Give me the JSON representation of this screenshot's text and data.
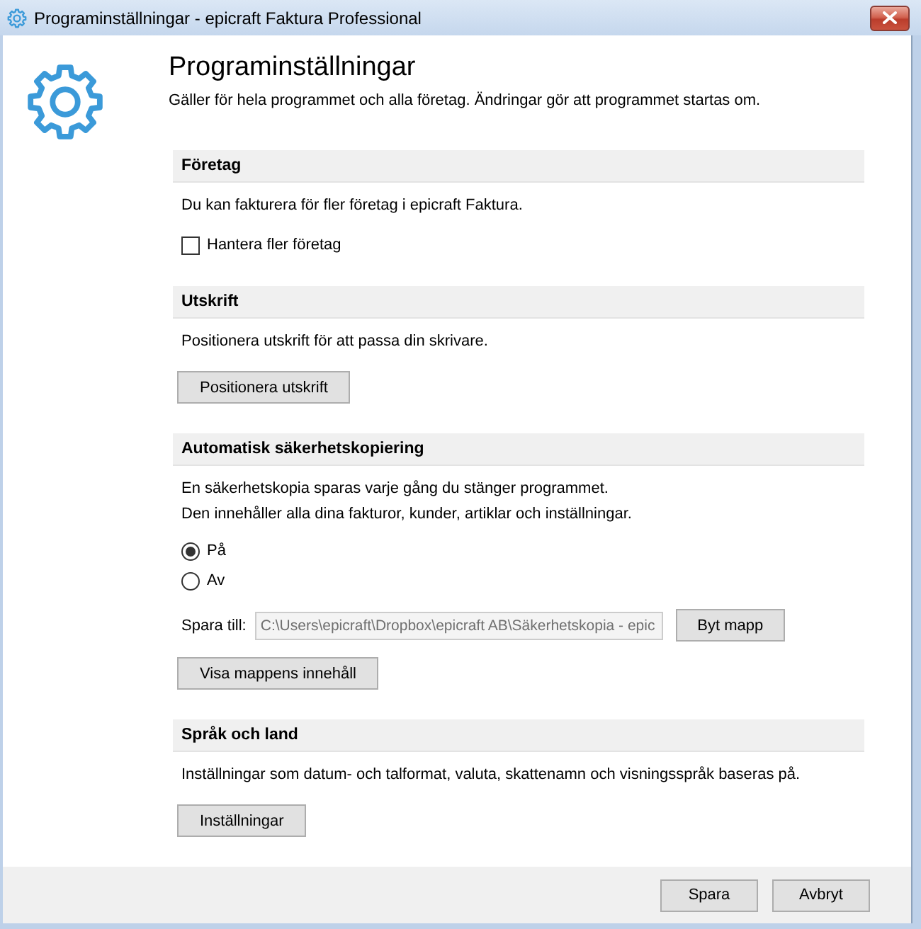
{
  "window": {
    "title": "Programinställningar - epicraft Faktura Professional"
  },
  "header": {
    "title": "Programinställningar",
    "subtitle": "Gäller för hela programmet och alla företag. Ändringar gör att programmet startas om."
  },
  "sections": [
    {
      "title": "Företag",
      "items": [
        {
          "kind": "text",
          "text": "Du kan fakturera för fler företag i epicraft Faktura."
        },
        {
          "kind": "checkbox",
          "label": "Hantera fler företag",
          "checked": false
        }
      ]
    },
    {
      "title": "Utskrift",
      "items": [
        {
          "kind": "text",
          "text": "Positionera utskrift för att passa din skrivare."
        },
        {
          "kind": "button",
          "label": "Positionera utskrift"
        }
      ]
    },
    {
      "title": "Automatisk säkerhetskopiering",
      "items": [
        {
          "kind": "text",
          "text": "En säkerhetskopia sparas varje gång du stänger programmet."
        },
        {
          "kind": "text",
          "text": "Den innehåller alla dina fakturor, kunder, artiklar och inställningar."
        },
        {
          "kind": "radio",
          "label": "På",
          "selected": true
        },
        {
          "kind": "radio",
          "label": "Av",
          "selected": false
        },
        {
          "kind": "folder",
          "label": "Spara till:",
          "value": "C:\\Users\\epicraft\\Dropbox\\epicraft AB\\Säkerhetskopia - epic",
          "disabled": true,
          "button": "Byt mapp"
        },
        {
          "kind": "button",
          "label": "Visa mappens innehåll"
        }
      ]
    },
    {
      "title": "Språk och land",
      "items": [
        {
          "kind": "text",
          "text": "Inställningar som datum- och talformat, valuta, skattenamn och visningsspråk baseras på."
        },
        {
          "kind": "button",
          "label": "Inställningar"
        }
      ]
    }
  ],
  "buttons": [
    "Spara",
    "Avbryt"
  ]
}
